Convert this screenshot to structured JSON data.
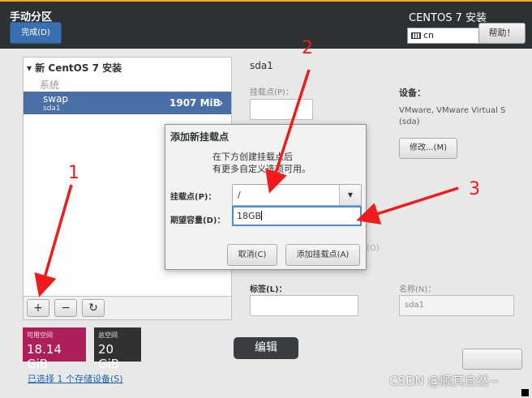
{
  "header": {
    "title": "手动分区",
    "done_label": "完成(D)",
    "product": "CENTOS 7 安装",
    "keyboard": "cn",
    "help_label": "帮助！"
  },
  "sidebar": {
    "group_title": "新 CentOS 7 安装",
    "section": "系统",
    "selected": {
      "name": "swap",
      "device": "sda1",
      "size": "1907 MiB"
    },
    "toolbar": {
      "add": "+",
      "remove": "−",
      "refresh": "↻"
    }
  },
  "storage": {
    "available_label": "可用空间",
    "available_value": "18.14 GiB",
    "total_label": "总空间",
    "total_value": "20 GiB",
    "selected_devices_link": "已选择 1 个存储设备(S)"
  },
  "details": {
    "title": "sda1",
    "mount_point_label": "挂载点(P)：",
    "device_label": "设备：",
    "device_value": "VMware, VMware Virtual S (sda)",
    "modify_label": "修改...(M)",
    "partial_letter": "(O)",
    "tag_label": "标签(L)：",
    "name_label": "名称(N)：",
    "name_value": "sda1"
  },
  "dialog": {
    "title": "添加新挂载点",
    "desc_line1": "在下方创建挂载点后",
    "desc_line2": "有更多自定义选项可用。",
    "mount_label": "挂载点(P)：",
    "mount_value": "/",
    "capacity_label": "期望容量(D)：",
    "capacity_value": "18GB",
    "cancel_label": "取消(C)",
    "add_label": "添加挂载点(A)"
  },
  "tooltip": {
    "edit": "编辑"
  },
  "annotations": {
    "marker1": "1",
    "marker2": "2",
    "marker3": "3",
    "arrow_color": "#ee1c1c"
  },
  "watermark": "CSDN @顺其自然~"
}
